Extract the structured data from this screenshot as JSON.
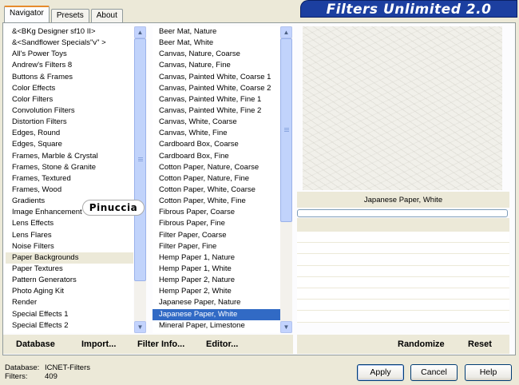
{
  "window": {
    "title": "Filters Unlimited 2.0"
  },
  "tabs": [
    "Navigator",
    "Presets",
    "About"
  ],
  "categories": {
    "items": [
      "&<BKg Designer sf10 II>",
      "&<Sandflower Specials\"v\" >",
      "All's Power Toys",
      "Andrew's Filters 8",
      "Buttons & Frames",
      "Color Effects",
      "Color Filters",
      "Convolution Filters",
      "Distortion Filters",
      "Edges, Round",
      "Edges, Square",
      "Frames, Marble & Crystal",
      "Frames, Stone & Granite",
      "Frames, Textured",
      "Frames, Wood",
      "Gradients",
      "Image Enhancement",
      "Lens Effects",
      "Lens Flares",
      "Noise Filters",
      "Paper Backgrounds",
      "Paper Textures",
      "Pattern Generators",
      "Photo Aging Kit",
      "Render",
      "Special Effects 1",
      "Special Effects 2"
    ],
    "highlighted": "Paper Backgrounds"
  },
  "filters": {
    "items": [
      "Beer Mat, Nature",
      "Beer Mat, White",
      "Canvas, Nature, Coarse",
      "Canvas, Nature, Fine",
      "Canvas, Painted White, Coarse 1",
      "Canvas, Painted White, Coarse 2",
      "Canvas, Painted White, Fine 1",
      "Canvas, Painted White, Fine 2",
      "Canvas, White, Coarse",
      "Canvas, White, Fine",
      "Cardboard Box, Coarse",
      "Cardboard Box, Fine",
      "Cotton Paper, Nature, Coarse",
      "Cotton Paper, Nature, Fine",
      "Cotton Paper, White, Coarse",
      "Cotton Paper, White, Fine",
      "Fibrous Paper, Coarse",
      "Fibrous Paper, Fine",
      "Filter Paper, Coarse",
      "Filter Paper, Fine",
      "Hemp Paper 1, Nature",
      "Hemp Paper 1, White",
      "Hemp Paper 2, Nature",
      "Hemp Paper 2, White",
      "Japanese Paper, Nature",
      "Japanese Paper, White",
      "Mineral Paper, Limestone"
    ],
    "selected": "Japanese Paper, White"
  },
  "preview": {
    "filter_name": "Japanese Paper, White"
  },
  "toolbar": {
    "database": "Database",
    "import": "Import...",
    "filter_info": "Filter Info...",
    "editor": "Editor...",
    "randomize": "Randomize",
    "reset": "Reset"
  },
  "watermark": "Pinuccia",
  "status": {
    "database_label": "Database:",
    "database_value": "ICNET-Filters",
    "filters_label": "Filters:",
    "filters_value": "409"
  },
  "buttons": {
    "apply": "Apply",
    "cancel": "Cancel",
    "help": "Help"
  },
  "icons": {
    "scroll_up": "chevron-up-icon",
    "scroll_down": "chevron-down-icon"
  },
  "colors": {
    "banner": "#1c3fa0",
    "selection": "#316ac5",
    "tab_accent": "#e68b2c",
    "dialog_bg": "#ece9d8"
  }
}
